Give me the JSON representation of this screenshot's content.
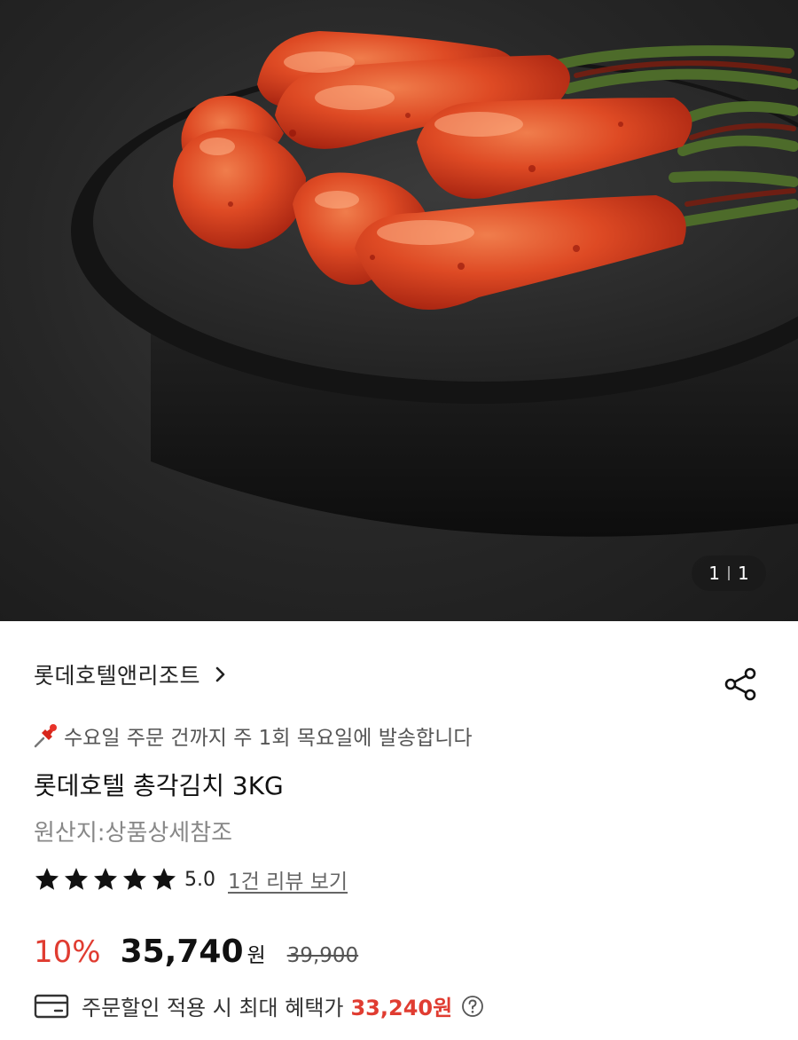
{
  "gallery": {
    "image_alt": "총각김치",
    "counter_current": "1",
    "counter_total": "1"
  },
  "product": {
    "brand": "롯데호텔앤리조트",
    "notice": "수요일 주문 건까지 주 1회 목요일에 발송합니다",
    "title": "롯데호텔 총각김치 3KG",
    "origin": "원산지:상품상세참조",
    "rating": "5.0",
    "rating_stars": 5,
    "review_link": "1건 리뷰 보기",
    "discount": "10%",
    "price": "35,740",
    "currency": "원",
    "original_price": "39,900",
    "benefit_text": "주문할인 적용 시 최대 혜택가",
    "benefit_price": "33,240원"
  },
  "icons": {
    "share": "share-icon",
    "pin": "pushpin-icon",
    "star": "star-icon",
    "card": "credit-card-icon",
    "help": "help-icon",
    "chevron": "chevron-right-icon"
  },
  "colors": {
    "accent": "#e03c31",
    "star": "#111111",
    "muted": "#888888"
  }
}
